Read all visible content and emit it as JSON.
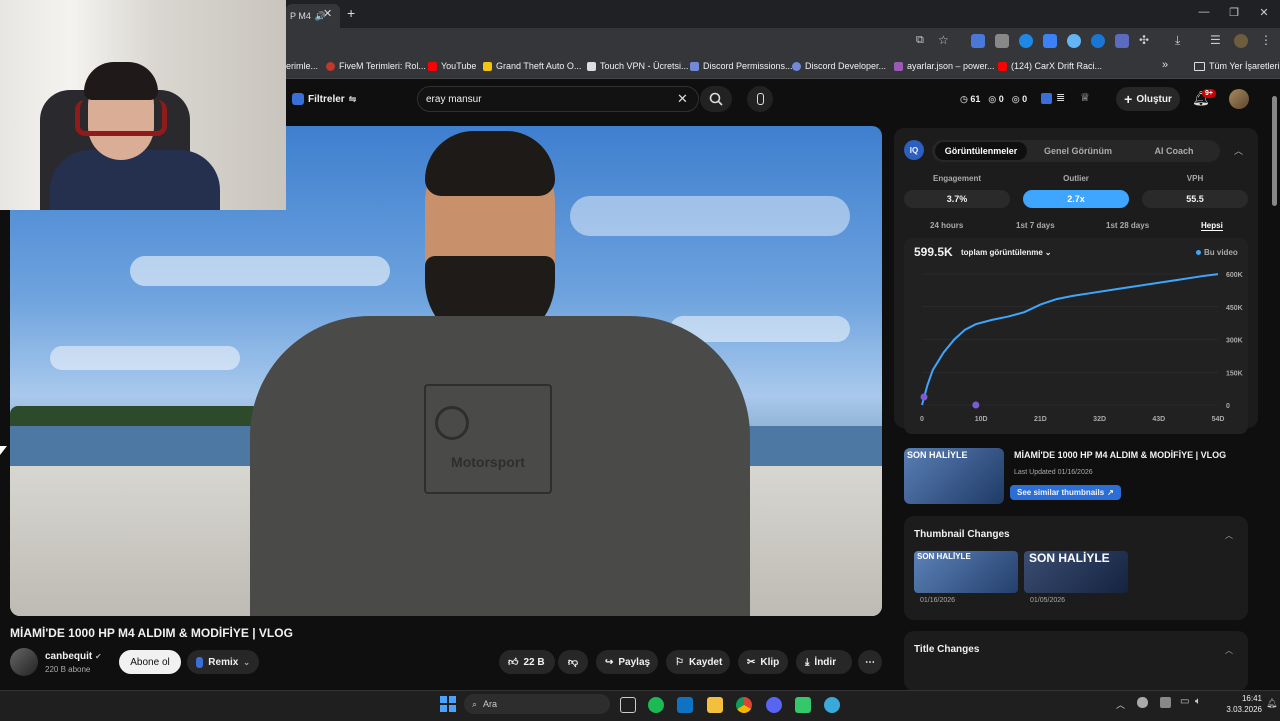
{
  "browser": {
    "tab_title": "P M4",
    "bookmarks": [
      {
        "label": "erimle...",
        "color": "#888"
      },
      {
        "label": "FiveM Terimleri: Rol...",
        "color": "#c0392b"
      },
      {
        "label": "YouTube",
        "color": "#ff0000"
      },
      {
        "label": "Grand Theft Auto O...",
        "color": "#f1c40f"
      },
      {
        "label": "Touch VPN - Ücretsi...",
        "color": "#ddd"
      },
      {
        "label": "Discord Permissions...",
        "color": "#7289da"
      },
      {
        "label": "Discord Developer...",
        "color": "#7289da"
      },
      {
        "label": "ayarlar.json – power...",
        "color": "#9b59b6"
      },
      {
        "label": "(124) CarX Drift Raci...",
        "color": "#ff0000"
      }
    ],
    "all_bookmarks": "Tüm Yer İşaretleri",
    "more_chevron": "»"
  },
  "yt_header": {
    "filters_label": "Filtreler",
    "search_value": "eray mansur",
    "stats": [
      "61",
      "0",
      "0"
    ],
    "create_label": "Oluştur",
    "notif_badge": "9+"
  },
  "video": {
    "title": "MİAMİ'DE 1000 HP M4 ALDIM & MODİFİYE | VLOG",
    "channel": "canbequit",
    "subscribers": "220 B abone",
    "subscribe_label": "Abone ol",
    "remix_label": "Remix",
    "likes": "22 B",
    "share_label": "Paylaş",
    "save_label": "Kaydet",
    "clip_label": "Klip",
    "download_label": "İndir",
    "shirt_text": "Motorsport"
  },
  "panel": {
    "tabs": [
      "Görüntülenmeler",
      "Genel Görünüm",
      "AI Coach"
    ],
    "metrics": [
      {
        "label": "Engagement",
        "value": "3.7%"
      },
      {
        "label": "Outlier",
        "value": "2.7x"
      },
      {
        "label": "VPH",
        "value": "55.5"
      }
    ],
    "ranges": [
      "24 hours",
      "1st 7 days",
      "1st 28 days",
      "Hepsi"
    ],
    "total_views": "599.5K",
    "views_selector": "toplam görüntülenme",
    "legend": "Bu video",
    "accent": "#3ea6ff"
  },
  "chart_data": {
    "type": "line",
    "x_tick_labels": [
      "0",
      "10D",
      "21D",
      "32D",
      "43D",
      "54D"
    ],
    "y_tick_labels": [
      "600K",
      "450K",
      "300K",
      "150K",
      "0"
    ],
    "xlim": [
      0,
      55
    ],
    "ylim": [
      0,
      600000
    ],
    "series": [
      {
        "name": "Bu video",
        "x": [
          0,
          1,
          2,
          4,
          6,
          8,
          10,
          13,
          16,
          19,
          22,
          25,
          28,
          32,
          36,
          40,
          44,
          48,
          52,
          55
        ],
        "y": [
          0,
          90000,
          160000,
          240000,
          300000,
          345000,
          370000,
          390000,
          405000,
          425000,
          460000,
          485000,
          500000,
          515000,
          530000,
          545000,
          560000,
          575000,
          590000,
          599500
        ]
      }
    ]
  },
  "thumb_card": {
    "title": "MİAMİ'DE 1000 HP M4 ALDIM & MODİFİYE | VLOG",
    "updated": "Last Updated 01/16/2026",
    "similar_label": "See similar thumbnails",
    "thumb_text": "SON HALİYLE"
  },
  "thumbnail_changes": {
    "heading": "Thumbnail Changes",
    "items": [
      {
        "date": "01/16/2026",
        "thumb_text": "SON HALİYLE"
      },
      {
        "date": "01/05/2026",
        "thumb_text": "SON HALİYLE"
      }
    ]
  },
  "title_changes": {
    "heading": "Title Changes"
  },
  "taskbar": {
    "search_label": "Ara",
    "time": "16:41",
    "date": "3.03.2026"
  }
}
